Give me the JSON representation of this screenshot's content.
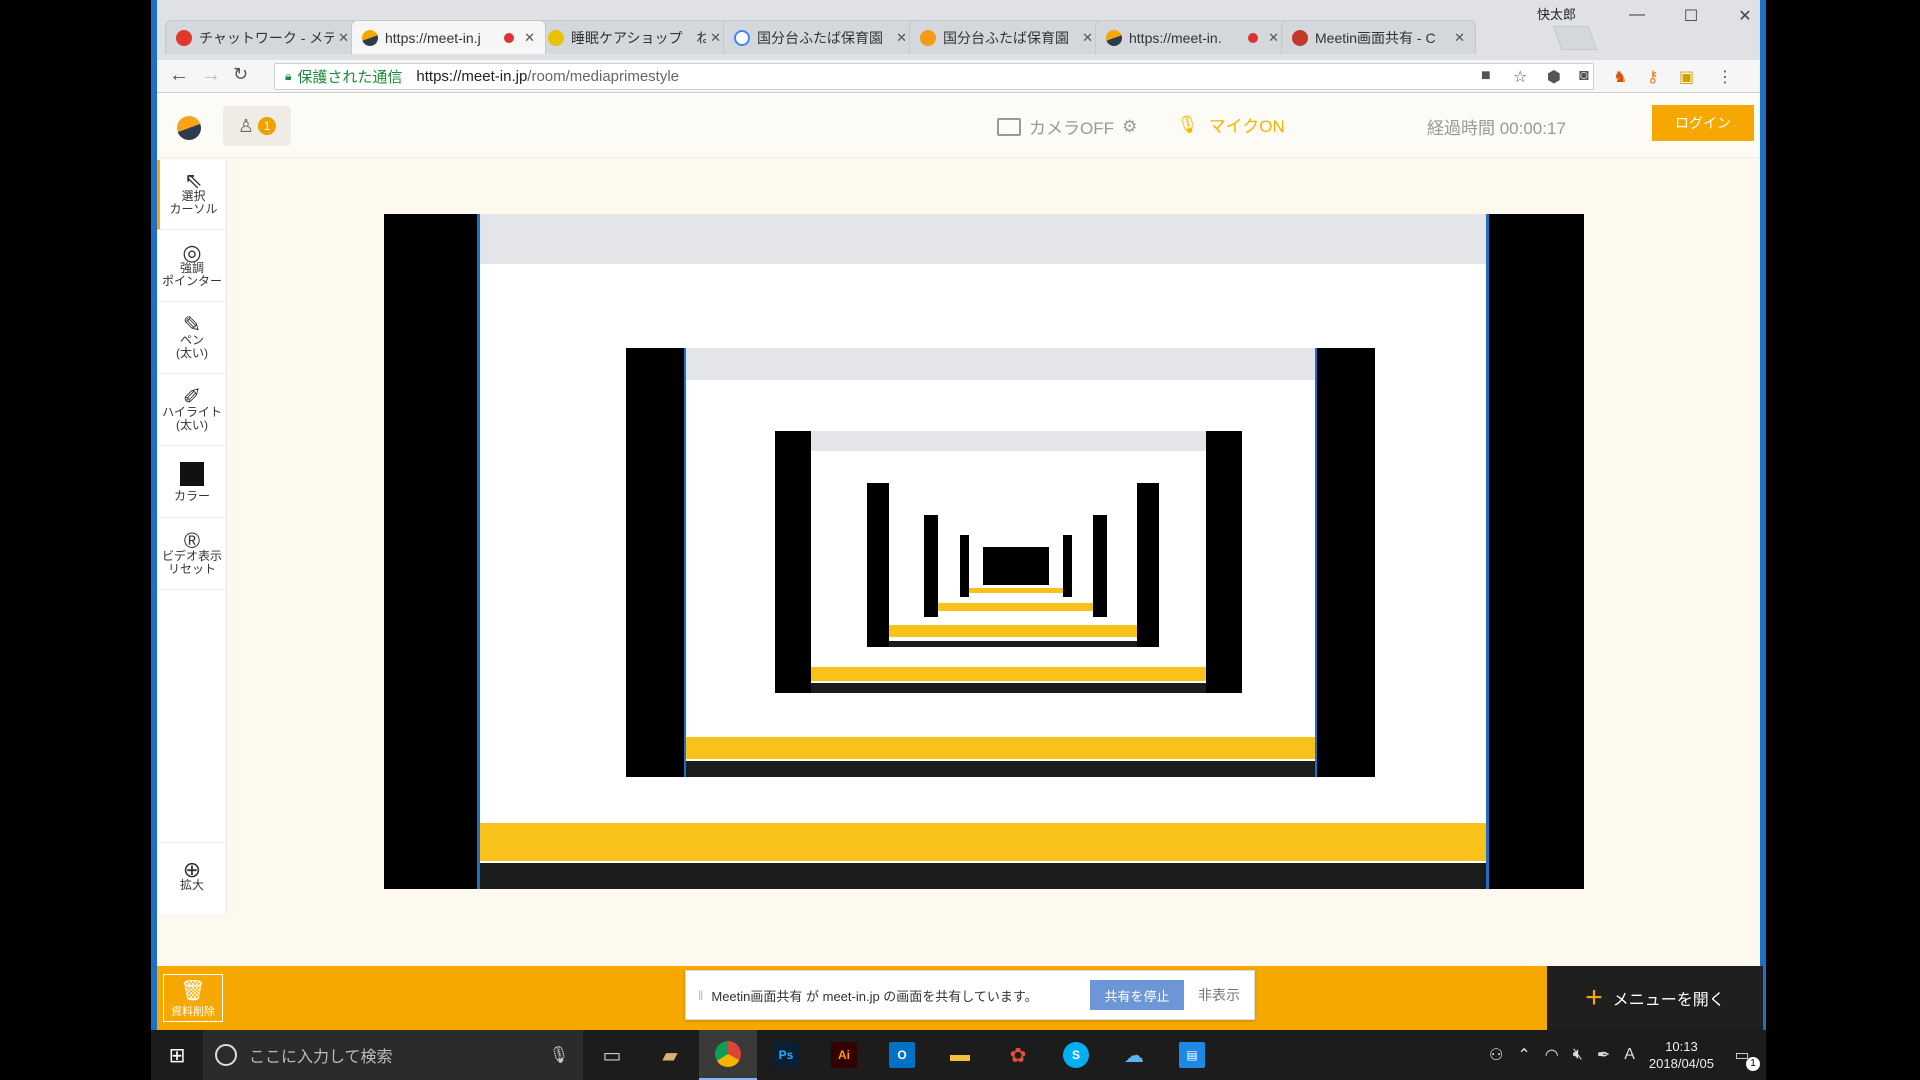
{
  "window": {
    "user_label": "快太郎",
    "tabs": [
      {
        "title": "チャットワーク - メディア",
        "favicon_color": "#e0392b",
        "recording": false
      },
      {
        "title": "https://meet-in.j",
        "favicon_color": "#f6a800",
        "recording": true
      },
      {
        "title": "睡眠ケアショップ　ね",
        "favicon_color": "#e8c200",
        "recording": false
      },
      {
        "title": "国分台ふたば保育園",
        "favicon_color": "#4285f4",
        "recording": false
      },
      {
        "title": "国分台ふたば保育園",
        "favicon_color": "#f39c12",
        "recording": false
      },
      {
        "title": "https://meet-in.",
        "favicon_color": "#f6a800",
        "recording": true
      },
      {
        "title": "Meetin画面共有 - C",
        "favicon_color": "#c0392b",
        "recording": false
      }
    ]
  },
  "omnibox": {
    "secure_label": "保護された通信",
    "url_host": "https://meet-in.jp",
    "url_path": "/room/mediaprimestyle"
  },
  "app": {
    "participant_count": "1",
    "camera_label": "カメラOFF",
    "mic_label": "マイクON",
    "elapsed_label": "経過時間 00:00:17",
    "login_label": "ログイン",
    "tools": [
      {
        "icon": "cursor-icon",
        "line1": "選択",
        "line2": "カーソル"
      },
      {
        "icon": "pointer-icon",
        "line1": "強調",
        "line2": "ポインター"
      },
      {
        "icon": "pen-icon",
        "line1": "ペン",
        "line2": "(太い)"
      },
      {
        "icon": "highlight-icon",
        "line1": "ハイライト",
        "line2": "(太い)"
      },
      {
        "icon": "color-icon",
        "line1": "カラー",
        "line2": ""
      },
      {
        "icon": "video-reset-icon",
        "line1": "ビデオ表示",
        "line2": "リセット"
      }
    ],
    "zoom_label": "拡大",
    "trash_label": "資料削除",
    "share_notice": "Meetin画面共有 が meet-in.jp の画面を共有しています。",
    "stop_share_label": "共有を停止",
    "hide_label": "非表示",
    "menu_label": "メニューを開く",
    "accent_color": "#f6a800"
  },
  "taskbar": {
    "search_placeholder": "ここに入力して検索",
    "time": "10:13",
    "date": "2018/04/05",
    "notification_count": "1",
    "ime_label": "A"
  }
}
